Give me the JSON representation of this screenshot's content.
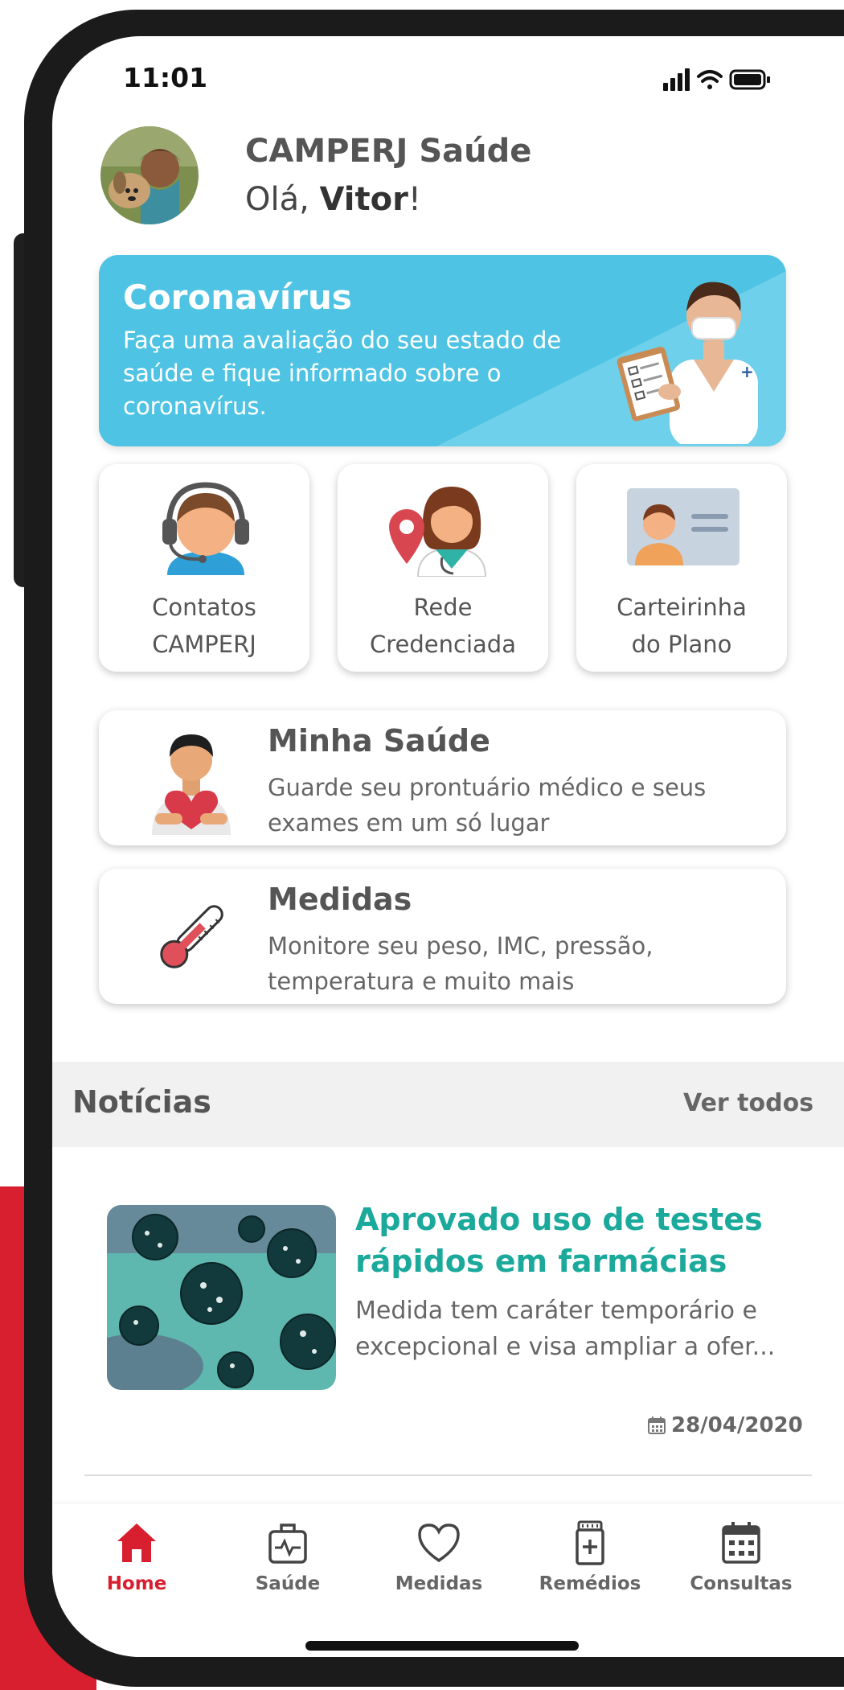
{
  "status": {
    "time": "11:01"
  },
  "header": {
    "app_name": "CAMPERJ Saúde",
    "greeting_prefix": "Olá, ",
    "user_name": "Vitor",
    "greeting_suffix": "!"
  },
  "banner": {
    "title": "Coronavírus",
    "text": "Faça uma avaliação do seu estado de saúde e fique informado sobre o coronavírus.",
    "color": "#4fc3e3"
  },
  "tiles": [
    {
      "line1": "Contatos",
      "line2": "CAMPERJ",
      "icon": "headset-agent-icon"
    },
    {
      "line1": "Rede",
      "line2": "Credenciada",
      "icon": "doctor-location-icon"
    },
    {
      "line1": "Carteirinha",
      "line2": "do Plano",
      "icon": "id-card-icon"
    }
  ],
  "cards": [
    {
      "title": "Minha Saúde",
      "text": "Guarde seu prontuário médico e seus exames em um só lugar",
      "icon": "person-heart-icon"
    },
    {
      "title": "Medidas",
      "text": "Monitore seu peso, IMC, pressão, temperatura e muito mais",
      "icon": "thermometer-icon"
    }
  ],
  "news": {
    "section_title": "Notícias",
    "see_all": "Ver todos",
    "items": [
      {
        "headline": "Aprovado uso de testes rápidos em farmácias",
        "snippet": "Medida tem caráter temporário e excepcional e visa ampliar a ofer...",
        "date": "28/04/2020"
      }
    ]
  },
  "tabbar": {
    "active_color": "#d81f2f",
    "items": [
      {
        "label": "Home",
        "icon": "home-icon",
        "active": true
      },
      {
        "label": "Saúde",
        "icon": "medical-bag-icon",
        "active": false
      },
      {
        "label": "Medidas",
        "icon": "heart-outline-icon",
        "active": false
      },
      {
        "label": "Remédios",
        "icon": "pill-bottle-icon",
        "active": false
      },
      {
        "label": "Consultas",
        "icon": "calendar-icon",
        "active": false
      }
    ]
  }
}
